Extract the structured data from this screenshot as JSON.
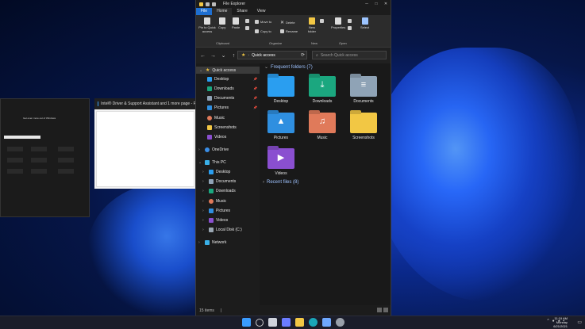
{
  "explorer": {
    "window_title": "File Explorer",
    "tabs": [
      "File",
      "Home",
      "Share",
      "View"
    ],
    "ribbon": {
      "pin_label": "Pin to Quick access",
      "copy": "Copy",
      "paste": "Paste",
      "move_to": "Move to",
      "copy_to": "Copy to",
      "delete": "Delete",
      "rename": "Rename",
      "new_folder": "New folder",
      "properties": "Properties",
      "select": "Select",
      "groups": [
        "Clipboard",
        "Organize",
        "New",
        "Open"
      ]
    },
    "address": "Quick access",
    "search_placeholder": "Search Quick access",
    "nav": {
      "quick_access": "Quick access",
      "qa_items": [
        "Desktop",
        "Downloads",
        "Documents",
        "Pictures",
        "Music",
        "Screenshots",
        "Videos"
      ],
      "onedrive": "OneDrive",
      "this_pc": "This PC",
      "pc_items": [
        "Desktop",
        "Documents",
        "Downloads",
        "Music",
        "Pictures",
        "Videos",
        "Local Disk (C:)"
      ],
      "network": "Network"
    },
    "frequent_header": "Frequent folders (7)",
    "folders": [
      {
        "name": "Desktop",
        "color": "#2a9ef0",
        "glyph": ""
      },
      {
        "name": "Downloads",
        "color": "#1ba77f",
        "glyph": "⤓"
      },
      {
        "name": "Documents",
        "color": "#8fa3b6",
        "glyph": "≡"
      },
      {
        "name": "Pictures",
        "color": "#2f8fe0",
        "glyph": "▲"
      },
      {
        "name": "Music",
        "color": "#e07a5a",
        "glyph": "♫"
      },
      {
        "name": "Screenshots",
        "color": "#f2c744",
        "glyph": ""
      },
      {
        "name": "Videos",
        "color": "#8a4fd0",
        "glyph": "▶"
      }
    ],
    "recent_header": "Recent files (8)",
    "status": "15 items"
  },
  "bg_window": {
    "title": "Intel® Driver & Support Assistant and 1 more page - P",
    "dark_text": "Get even more out of Windows"
  },
  "taskbar": {
    "time": "11:19 AM",
    "day": "Monday",
    "date": "6/21/2021"
  }
}
